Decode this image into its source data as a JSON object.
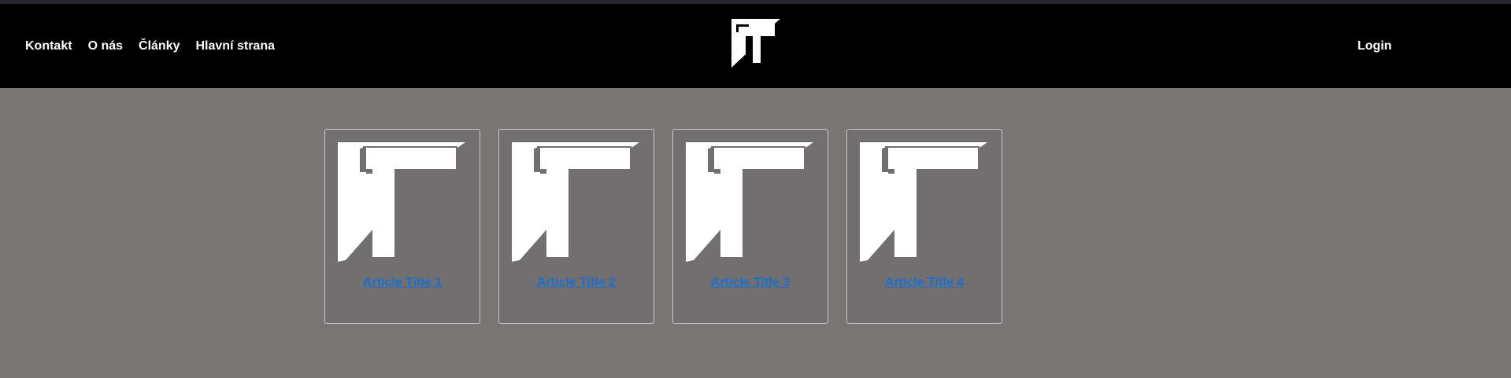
{
  "nav": {
    "links": [
      "Kontakt",
      "O nás",
      "Články",
      "Hlavní strana"
    ],
    "login_label": "Login",
    "logo_icon": "t-logo-icon"
  },
  "articles": [
    {
      "title": "Article Title 1",
      "image_icon": "t-logo-icon"
    },
    {
      "title": "Article Title 2",
      "image_icon": "t-logo-icon"
    },
    {
      "title": "Article Title 3",
      "image_icon": "t-logo-icon"
    },
    {
      "title": "Article Title 4",
      "image_icon": "t-logo-icon"
    }
  ],
  "colors": {
    "navbar": "#000000",
    "page_background": "#787674",
    "card_background": "#716f6f",
    "link": "#1a6fd1"
  }
}
